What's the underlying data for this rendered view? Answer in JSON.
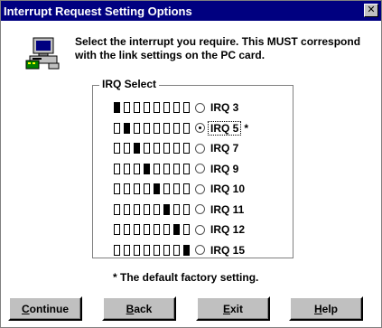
{
  "window": {
    "title": "Interrupt Request Setting Options",
    "close_glyph": "✕"
  },
  "header": {
    "icon": "computer-with-card-icon",
    "instruction": "Select the interrupt you require. This MUST correspond with the link settings on the  PC card."
  },
  "irq_group": {
    "title": "IRQ Select",
    "options": [
      {
        "label": "IRQ 3",
        "bits": [
          1,
          0,
          0,
          0,
          0,
          0,
          0,
          0
        ],
        "selected": false,
        "note": ""
      },
      {
        "label": "IRQ 5",
        "bits": [
          0,
          1,
          0,
          0,
          0,
          0,
          0,
          0
        ],
        "selected": true,
        "note": "*"
      },
      {
        "label": "IRQ 7",
        "bits": [
          0,
          0,
          1,
          0,
          0,
          0,
          0,
          0
        ],
        "selected": false,
        "note": ""
      },
      {
        "label": "IRQ 9",
        "bits": [
          0,
          0,
          0,
          1,
          0,
          0,
          0,
          0
        ],
        "selected": false,
        "note": ""
      },
      {
        "label": "IRQ 10",
        "bits": [
          0,
          0,
          0,
          0,
          1,
          0,
          0,
          0
        ],
        "selected": false,
        "note": ""
      },
      {
        "label": "IRQ 11",
        "bits": [
          0,
          0,
          0,
          0,
          0,
          1,
          0,
          0
        ],
        "selected": false,
        "note": ""
      },
      {
        "label": "IRQ 12",
        "bits": [
          0,
          0,
          0,
          0,
          0,
          0,
          1,
          0
        ],
        "selected": false,
        "note": ""
      },
      {
        "label": "IRQ 15",
        "bits": [
          0,
          0,
          0,
          0,
          0,
          0,
          0,
          1
        ],
        "selected": false,
        "note": ""
      }
    ]
  },
  "footnote": "* The default factory setting.",
  "buttons": {
    "continue": {
      "mnemonic": "C",
      "rest": "ontinue"
    },
    "back": {
      "mnemonic": "B",
      "rest": "ack"
    },
    "exit": {
      "mnemonic": "E",
      "rest": "xit"
    },
    "help": {
      "mnemonic": "H",
      "rest": "elp"
    }
  },
  "colors": {
    "titlebar": "#000080",
    "button_face": "#c0c0c0"
  }
}
